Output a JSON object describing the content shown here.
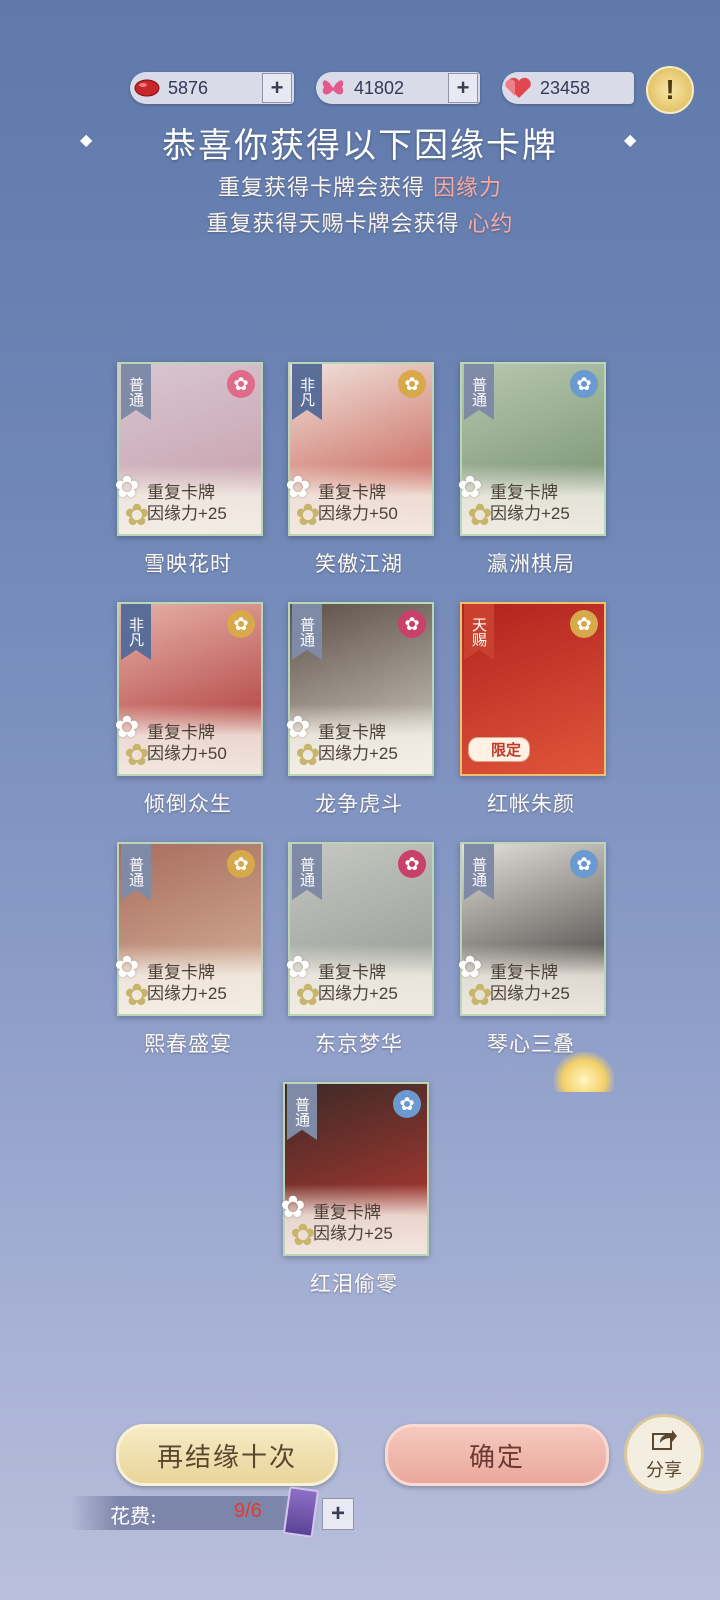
{
  "currencies": [
    {
      "icon": "red-gem-icon",
      "value": "5876"
    },
    {
      "icon": "butterfly-icon",
      "value": "41802"
    },
    {
      "icon": "heart-icon",
      "value": "23458"
    }
  ],
  "title": "恭喜你获得以下因缘卡牌",
  "subtitle1": {
    "text": "重复获得卡牌会获得",
    "highlight": "因缘力"
  },
  "subtitle2": {
    "text": "重复获得天赐卡牌会获得",
    "highlight": "心约"
  },
  "cards": [
    {
      "name": "雪映花时",
      "rarity": "普通",
      "dup1": "重复卡牌",
      "dup2": "因缘力+25",
      "colors": [
        "#d8c7d2",
        "#c49aa5"
      ]
    },
    {
      "name": "笑傲江湖",
      "rarity": "非凡",
      "dup1": "重复卡牌",
      "dup2": "因缘力+50",
      "colors": [
        "#efe3dc",
        "#c24a3e"
      ]
    },
    {
      "name": "瀛洲棋局",
      "rarity": "普通",
      "dup1": "重复卡牌",
      "dup2": "因缘力+25",
      "colors": [
        "#b7c8b0",
        "#6f8a6a"
      ]
    },
    {
      "name": "倾倒众生",
      "rarity": "非凡",
      "dup1": "重复卡牌",
      "dup2": "因缘力+50",
      "colors": [
        "#e5b2a8",
        "#a8292a"
      ]
    },
    {
      "name": "龙争虎斗",
      "rarity": "普通",
      "dup1": "重复卡牌",
      "dup2": "因缘力+25",
      "colors": [
        "#5d5048",
        "#d7d3c8"
      ]
    },
    {
      "name": "红帐朱颜",
      "rarity": "天赐",
      "limited": "限定",
      "colors": [
        "#b0231f",
        "#e0563a"
      ]
    },
    {
      "name": "熙春盛宴",
      "rarity": "普通",
      "dup1": "重复卡牌",
      "dup2": "因缘力+25",
      "colors": [
        "#a96d5e",
        "#d9b8a0"
      ]
    },
    {
      "name": "东京梦华",
      "rarity": "普通",
      "dup1": "重复卡牌",
      "dup2": "因缘力+25",
      "colors": [
        "#c7c8c2",
        "#8e9590"
      ]
    },
    {
      "name": "琴心三叠",
      "rarity": "普通",
      "dup1": "重复卡牌",
      "dup2": "因缘力+25",
      "colors": [
        "#e3e1dc",
        "#2f2a28"
      ]
    },
    {
      "name": "红泪偷零",
      "rarity": "普通",
      "dup1": "重复卡牌",
      "dup2": "因缘力+25",
      "colors": [
        "#3b2a26",
        "#c23a34"
      ]
    }
  ],
  "buttons": {
    "retry": "再结缘十次",
    "confirm": "确定",
    "share": "分享"
  },
  "cost": {
    "label": "花费:",
    "value": "9/6"
  }
}
